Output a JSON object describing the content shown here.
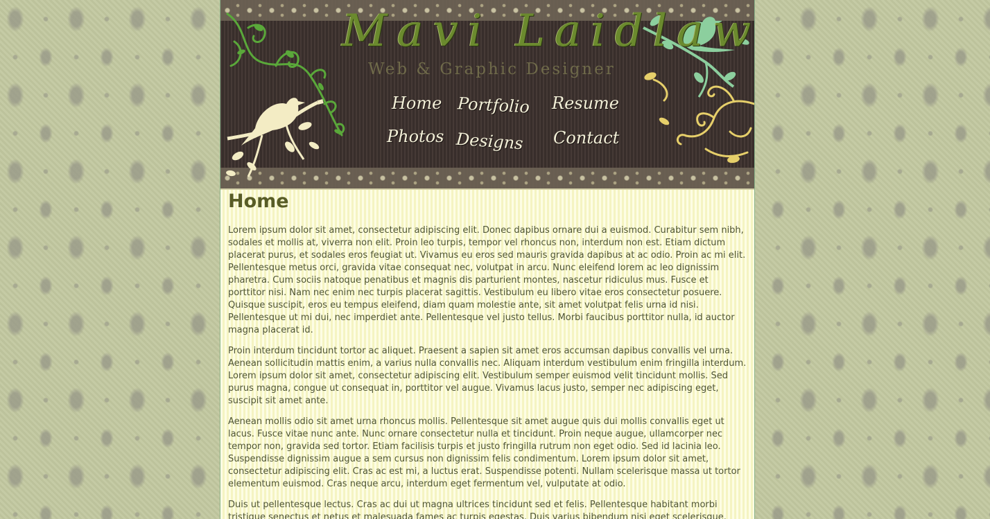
{
  "header": {
    "brand_name": "Mavi Laidlaw",
    "brand_tagline": "Web & Graphic Designer",
    "nav": {
      "home": "Home",
      "portfolio": "Portfolio",
      "resume": "Resume",
      "photos": "Photos",
      "designs": "Designs",
      "contact": "Contact"
    }
  },
  "main": {
    "heading": "Home",
    "paragraphs": [
      "Lorem ipsum dolor sit amet, consectetur adipiscing elit. Donec dapibus ornare dui a euismod. Curabitur sem nibh, sodales et mollis at, viverra non elit. Proin leo turpis, tempor vel rhoncus non, interdum non est. Etiam dictum placerat purus, et sodales eros feugiat ut. Vivamus eu eros sed mauris gravida dapibus at ac odio. Proin ac mi elit. Pellentesque metus orci, gravida vitae consequat nec, volutpat in arcu. Nunc eleifend lorem ac leo dignissim pharetra. Cum sociis natoque penatibus et magnis dis parturient montes, nascetur ridiculus mus. Fusce et porttitor nisi. Nam nec enim nec turpis placerat sagittis. Vestibulum eu libero vitae eros consectetur posuere. Quisque suscipit, eros eu tempus eleifend, diam quam molestie ante, sit amet volutpat felis urna id nisi. Pellentesque ut mi dui, nec imperdiet ante. Pellentesque vel justo tellus. Morbi faucibus porttitor nulla, id auctor magna placerat id.",
      "Proin interdum tincidunt tortor ac aliquet. Praesent a sapien sit amet eros accumsan dapibus convallis vel urna. Aenean sollicitudin mattis enim, a varius nulla convallis nec. Aliquam interdum vestibulum enim fringilla interdum. Lorem ipsum dolor sit amet, consectetur adipiscing elit. Vestibulum semper euismod velit tincidunt mollis. Sed purus magna, congue ut consequat in, porttitor vel augue. Vivamus lacus justo, semper nec adipiscing eget, suscipit sit amet ante.",
      "Aenean mollis odio sit amet urna rhoncus mollis. Pellentesque sit amet augue quis dui mollis convallis eget ut lacus. Fusce vitae nunc ante. Nunc ornare consectetur nulla et tincidunt. Proin neque augue, ullamcorper nec tempor non, gravida sed tortor. Etiam facilisis turpis et justo fringilla rutrum non eget odio. Sed id lacinia leo. Suspendisse dignissim augue a sem cursus non dignissim felis condimentum. Lorem ipsum dolor sit amet, consectetur adipiscing elit. Cras ac est mi, a luctus erat. Suspendisse potenti. Nullam scelerisque massa ut tortor elementum euismod. Cras neque arcu, interdum eget fermentum vel, vulputate at odio.",
      "Duis ut pellentesque lectus. Cras ac dui ut magna ultrices tincidunt sed et felis. Pellentesque habitant morbi tristique senectus et netus et malesuada fames ac turpis egestas. Duis varius bibendum nisi eget scelerisque."
    ]
  },
  "colors": {
    "page_background": "#c2c8a0",
    "damask_pattern": "#96968a",
    "header_background": "#3e3431",
    "content_background": "#fcfbd6",
    "heading_text": "#585c26",
    "body_text": "#4f5535",
    "nav_text": "#f3f0d8",
    "brand_green": "#6b8a2e",
    "bird_cream": "#f3ecc4",
    "bird_mint": "#8ccf9e",
    "swirl_yellow": "#e6cf6a",
    "swirl_green": "#5aa83a"
  },
  "icons": {
    "left_bird": "cream-bird-icon",
    "right_bird": "mint-bird-icon",
    "left_swirl": "green-swirl-icon",
    "right_swirl": "yellow-swirl-icon"
  }
}
